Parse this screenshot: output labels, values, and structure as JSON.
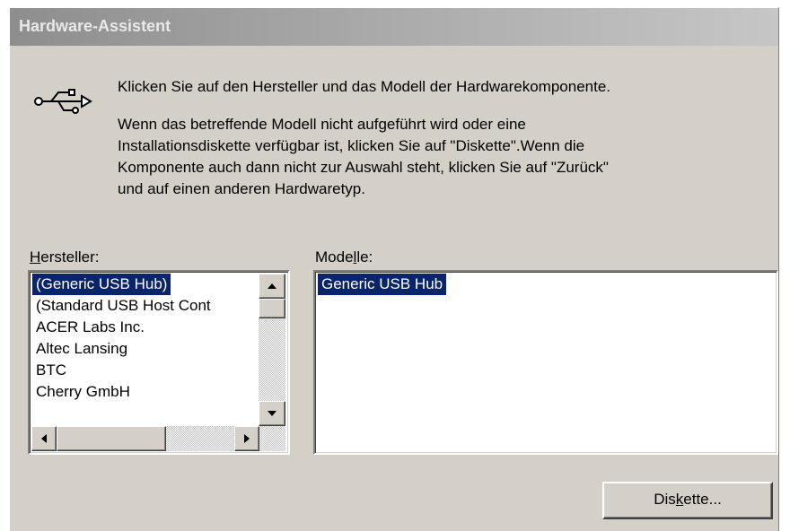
{
  "window": {
    "title": "Hardware-Assistent"
  },
  "icons": {
    "usb": "usb-icon"
  },
  "instructions": {
    "intro": "Klicken Sie auf den Hersteller und das Modell der Hardwarekomponente.",
    "lines": [
      "Wenn das betreffende Modell nicht aufgeführt wird oder eine",
      "Installationsdiskette verfügbar ist, klicken Sie auf \"Diskette\".Wenn die",
      "Komponente auch dann nicht zur Auswahl steht, klicken Sie auf \"Zurück\"",
      "und auf einen anderen Hardwaretyp."
    ]
  },
  "manufacturers": {
    "label_first": "H",
    "label_rest": "ersteller:",
    "items": [
      "(Generic USB Hub)",
      "(Standard USB Host Cont",
      "ACER Labs Inc.",
      "Altec Lansing",
      "BTC",
      "Cherry GmbH"
    ],
    "selected": "(Generic USB Hub)"
  },
  "models": {
    "label_before": "Mode",
    "label_mnemonic": "l",
    "label_after": "le:",
    "items": [
      "Generic USB Hub"
    ],
    "selected": "Generic USB Hub"
  },
  "buttons": {
    "disk_before": "Dis",
    "disk_mnemonic": "k",
    "disk_after": "ette..."
  },
  "colors": {
    "dialog_bg": "#d4d0c8",
    "selection_bg": "#0a246a",
    "selection_fg": "#ffffff"
  }
}
